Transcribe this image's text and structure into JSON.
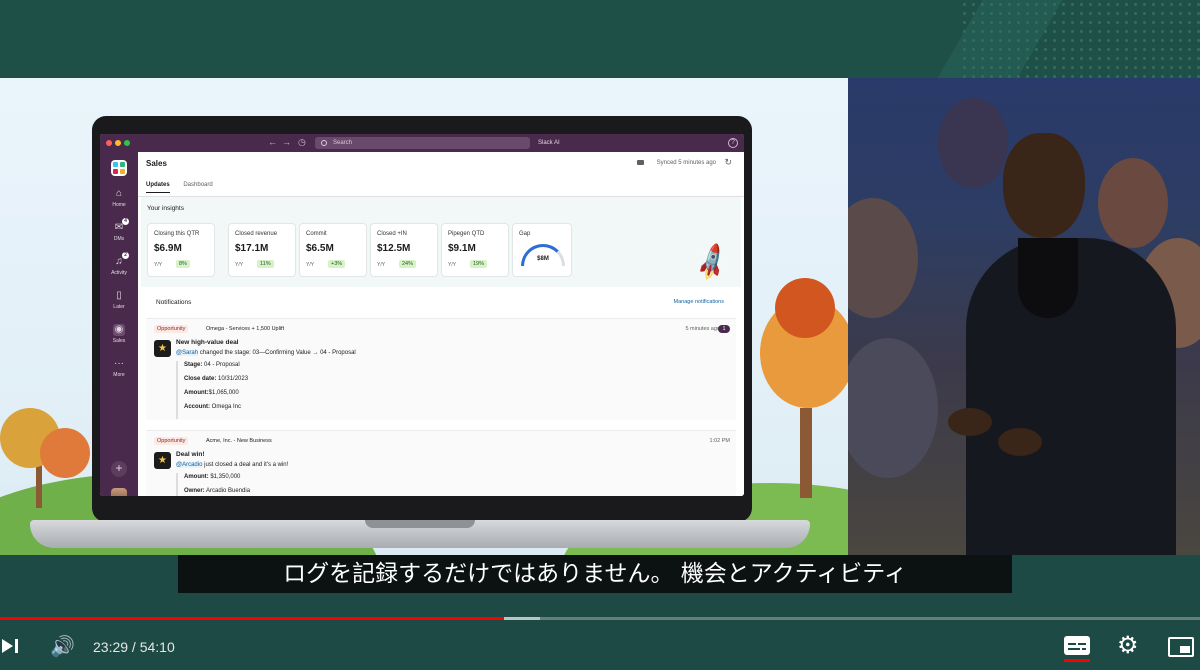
{
  "slack": {
    "search_placeholder": "Search",
    "ai_label": "Slack AI",
    "channel_title": "Sales",
    "synced": "Synced 5 minutes ago",
    "tabs": [
      {
        "label": "Updates"
      },
      {
        "label": "Dashboard"
      }
    ],
    "rail": [
      {
        "label": "Home",
        "icon": "home-icon"
      },
      {
        "label": "DMs",
        "icon": "dms-icon",
        "badge": "4"
      },
      {
        "label": "Activity",
        "icon": "bell-icon",
        "badge": "2"
      },
      {
        "label": "Later",
        "icon": "bookmark-icon"
      },
      {
        "label": "Sales",
        "icon": "sales-icon"
      },
      {
        "label": "More",
        "icon": "more-icon"
      }
    ],
    "insights_title": "Your insights",
    "cards": [
      {
        "label": "Closing this QTR",
        "value": "$6.9M",
        "yy": "Y/Y",
        "change": "8%"
      },
      {
        "label": "Closed revenue",
        "value": "$17.1M",
        "yy": "Y/Y",
        "change": "11%"
      },
      {
        "label": "Commit",
        "value": "$6.5M",
        "yy": "Y/Y",
        "change": "+3%"
      },
      {
        "label": "Closed +IN",
        "value": "$12.5M",
        "yy": "Y/Y",
        "change": "24%"
      },
      {
        "label": "Pipegen QTD",
        "value": "$9.1M",
        "yy": "Y/Y",
        "change": "19%"
      }
    ],
    "gap": {
      "label": "Gap",
      "value": "$8M"
    },
    "notifications_title": "Notifications",
    "manage_label": "Manage notifications",
    "notifications": [
      {
        "tag": "Opportunity",
        "name": "Omega - Services + 1,500 Uplift",
        "time": "5 minutes ago",
        "count": "1",
        "title": "New high-value deal",
        "mention": "@Sarah",
        "text": " changed the stage: 03—Confirming Value → 04 - Proposal",
        "details": [
          {
            "k": "Stage:",
            "v": " 04 - Proposal"
          },
          {
            "k": "Close date:",
            "v": " 10/31/2023"
          },
          {
            "k": "Amount:",
            "v": "$1,065,000"
          },
          {
            "k": "Account:",
            "v": " Omega Inc"
          }
        ]
      },
      {
        "tag": "Opportunity",
        "name": "Acme, Inc. - New Business",
        "time": "1:02 PM",
        "title": "Deal win!",
        "mention": "@Arcadio",
        "text": " just closed a deal and it's a win!",
        "details": [
          {
            "k": "Amount:",
            "v": " $1,350,000"
          },
          {
            "k": "Owner:",
            "v": " Arcadio Buendia"
          }
        ]
      }
    ]
  },
  "caption": "ログを記録するだけではありません。 機会とアクティビティ",
  "player": {
    "time": "23:29 / 54:10",
    "played_fraction": 0.42,
    "buffered_fraction": 0.45,
    "icons": [
      "next-icon",
      "volume-icon",
      "subtitles-icon",
      "settings-icon",
      "miniplayer-icon"
    ]
  }
}
